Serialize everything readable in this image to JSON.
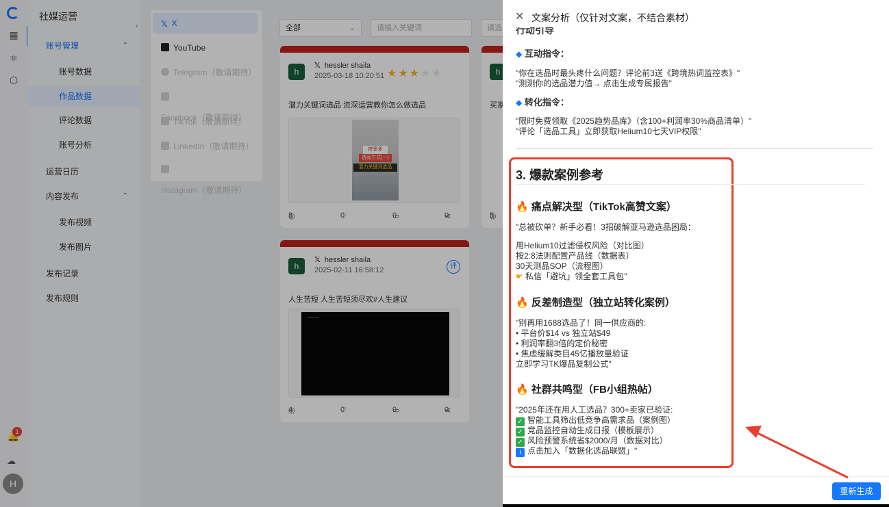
{
  "app": {
    "title": "社媒运营"
  },
  "nav": {
    "items": [
      {
        "label": "账号管理",
        "kind": "group-active"
      },
      {
        "label": "账号数据",
        "kind": "sub"
      },
      {
        "label": "作品数据",
        "kind": "sub-selected"
      },
      {
        "label": "评论数据",
        "kind": "sub"
      },
      {
        "label": "账号分析",
        "kind": "sub"
      },
      {
        "label": "运营日历",
        "kind": "group"
      },
      {
        "label": "内容发布",
        "kind": "group"
      },
      {
        "label": "发布视频",
        "kind": "sub"
      },
      {
        "label": "发布图片",
        "kind": "sub"
      },
      {
        "label": "发布记录",
        "kind": "group"
      },
      {
        "label": "发布规则",
        "kind": "group"
      }
    ],
    "notification_count": "1",
    "avatar_letter": "H"
  },
  "platforms": [
    {
      "label": "X",
      "state": "active",
      "icon": "x-icon"
    },
    {
      "label": "YouTube",
      "state": "normal",
      "icon": "youtube-icon"
    },
    {
      "label": "Telegram（敬请期待）",
      "state": "disabled",
      "icon": "telegram-icon"
    },
    {
      "label": "Facebook（敬请期待）",
      "state": "disabled",
      "icon": "facebook-icon"
    },
    {
      "label": "TikTok（敬请期待）",
      "state": "disabled",
      "icon": "tiktok-icon"
    },
    {
      "label": "LinkedIn（敬请期待）",
      "state": "disabled",
      "icon": "linkedin-icon"
    },
    {
      "label": "Instagram（敬请期待）",
      "state": "disabled",
      "icon": "instagram-icon"
    }
  ],
  "filters": {
    "all_select": "全部",
    "keyword_placeholder": "请输入关键词",
    "third_placeholder": "请选"
  },
  "cards": [
    {
      "avatar": "h",
      "user": "hessler shaila",
      "date": "2025-03-18 10:20:51",
      "rating": 3,
      "rating_max": 5,
      "description": "潜力关键词选品 资深运营教你怎么做选品",
      "thumb_lines": [
        "拼多多",
        "选品方式(一)",
        "潜力关键词选品"
      ],
      "plays": "8",
      "likes": "0",
      "comments": "0",
      "shares": "0"
    },
    {
      "avatar": "h",
      "user": "hessler shaila",
      "date": "2025-02-11 16:58:12",
      "review_badge": "评",
      "description": "人生苦短 人生苦短须尽欢#人生建议",
      "plays": "4",
      "likes": "0",
      "comments": "0",
      "shares": "0"
    }
  ],
  "partial_card": {
    "avatar": "h",
    "text": "买家",
    "plays": "5"
  },
  "drawer": {
    "title": "文案分析（仅针对文案，不结合素材）",
    "cut_heading": "行动引导",
    "interaction_heading": "互动指令：",
    "interaction_lines": [
      "\"你在选品时最头疼什么问题？评论前3送《跨境热词监控表》\"",
      "\"测测你的选品潜力值→ 点击生成专属报告\""
    ],
    "conversion_heading": "转化指令：",
    "conversion_lines": [
      "\"限时免费领取《2025趋势品库》（含100+利润率30%商品清单）\"",
      "\"评论「选品工具」立即获取Helium10七天VIP权限\""
    ],
    "section_title": "3. 爆款案例参考",
    "cases": [
      {
        "title": "痛点解决型（TikTok高赞文案）",
        "lines": [
          "\"总被砍单？新手必看！3招破解亚马逊选品困局：",
          "",
          "用Helium10过滤侵权风险（对比图）",
          "按2:8法则配置产品线（数据表）",
          "30天测品SOP（流程图）",
          "私信「避坑」领全套工具包\""
        ]
      },
      {
        "title": "反差制造型（独立站转化案例）",
        "lines": [
          "\"别再用1688选品了！同一供应商的:",
          "• 平台价$14 vs 独立站$49",
          "• 利润率翻3倍的定价秘密",
          "• 焦虑缓解类目45亿播放量验证",
          "立即学习TK爆品复制公式\""
        ]
      },
      {
        "title": "社群共鸣型（FB小组热帖）",
        "lines": [
          "\"2025年还在用人工选品？300+卖家已验证:",
          "智能工具筛出低竞争高需求品（案例图）",
          "竞品监控自动生成日报（模板展示）",
          "风险预警系统省$2000/月（数据对比）",
          "点击加入「数据化选品联盟」\""
        ]
      }
    ],
    "regenerate_button": "重新生成"
  },
  "colors": {
    "accent": "#1677ff",
    "card_top": "#c0211b",
    "highlight": "#e8402f"
  }
}
